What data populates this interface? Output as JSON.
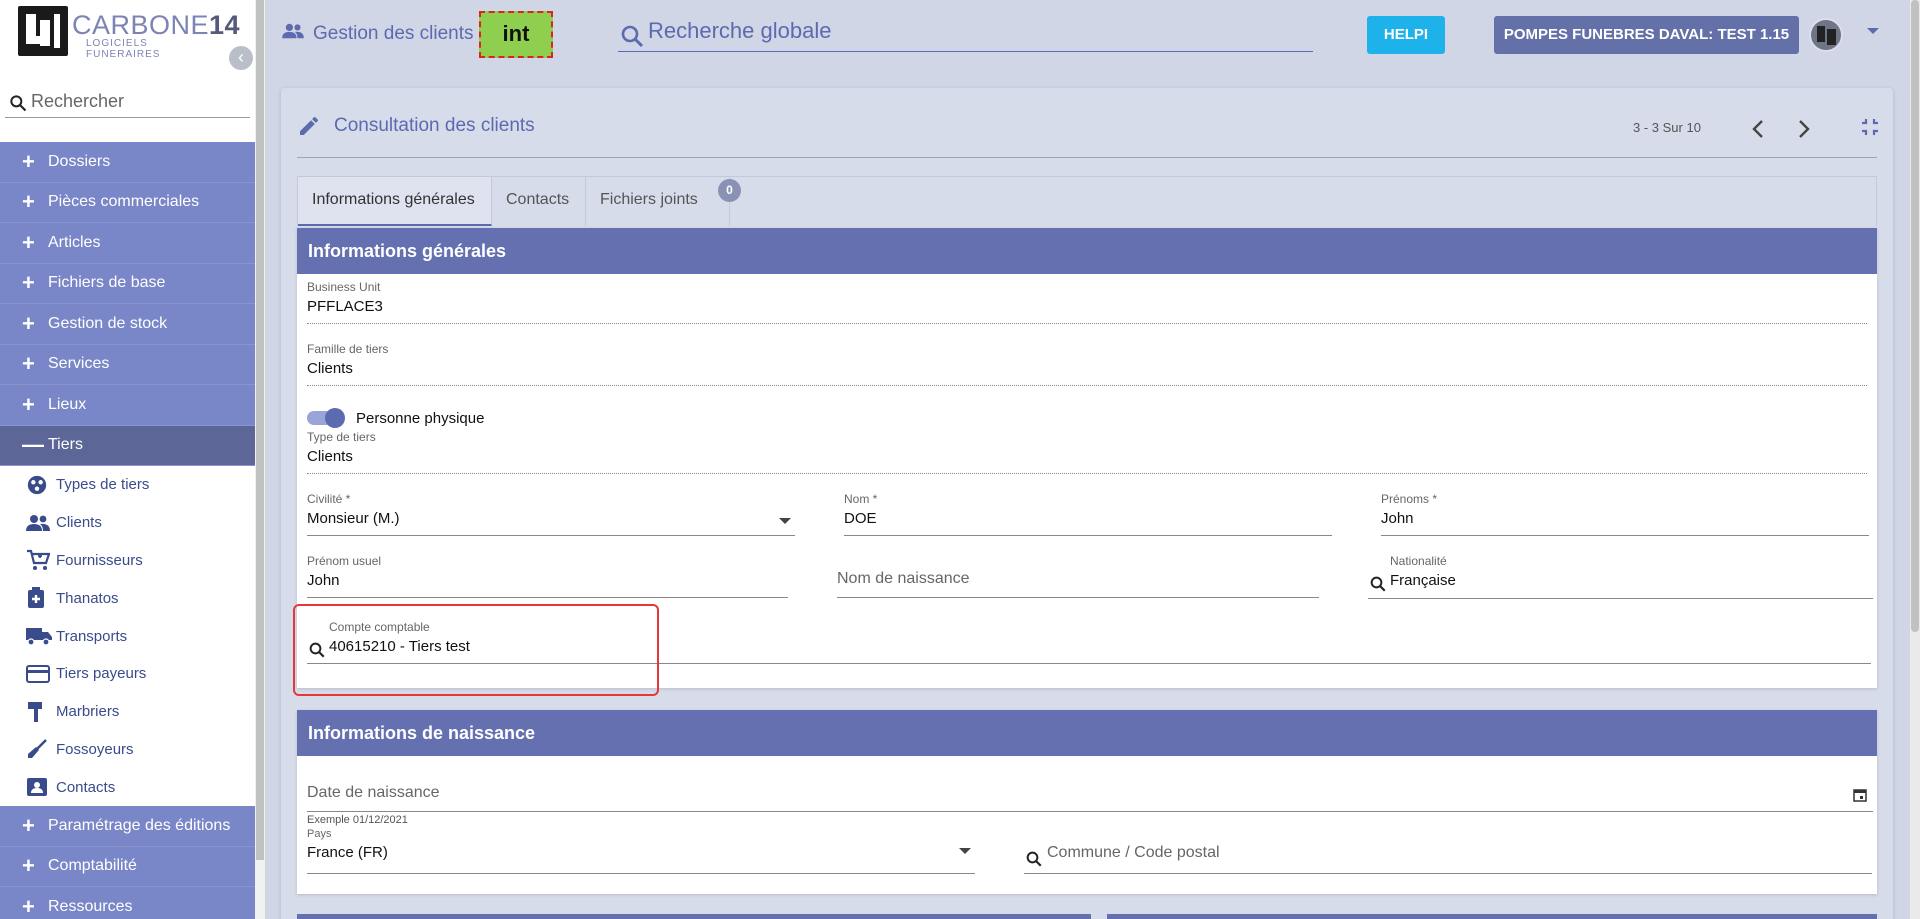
{
  "brand": {
    "name_main": "CARBONE",
    "name_bold": "14",
    "subtitle": "LOGICIELS FUNERAIRES"
  },
  "sidebar": {
    "search_placeholder": "Rechercher",
    "collapse_glyph": "‹",
    "items": [
      {
        "label": "Dossiers",
        "sym": "+"
      },
      {
        "label": "Pièces commerciales",
        "sym": "+"
      },
      {
        "label": "Articles",
        "sym": "+"
      },
      {
        "label": "Fichiers de base",
        "sym": "+"
      },
      {
        "label": "Gestion de stock",
        "sym": "+"
      },
      {
        "label": "Services",
        "sym": "+"
      },
      {
        "label": "Lieux",
        "sym": "+"
      },
      {
        "label": "Tiers",
        "sym": "—"
      }
    ],
    "subitems": [
      {
        "label": "Types de tiers",
        "icon": "types-icon"
      },
      {
        "label": "Clients",
        "icon": "people-icon"
      },
      {
        "label": "Fournisseurs",
        "icon": "cart-icon"
      },
      {
        "label": "Thanatos",
        "icon": "medical-icon"
      },
      {
        "label": "Transports",
        "icon": "truck-icon"
      },
      {
        "label": "Tiers payeurs",
        "icon": "card-icon"
      },
      {
        "label": "Marbriers",
        "icon": "hammer-icon"
      },
      {
        "label": "Fossoyeurs",
        "icon": "shovel-icon"
      },
      {
        "label": "Contacts",
        "icon": "contact-icon"
      }
    ],
    "items_after": [
      {
        "label": "Paramétrage des éditions",
        "sym": "+"
      },
      {
        "label": "Comptabilité",
        "sym": "+"
      },
      {
        "label": "Ressources",
        "sym": "+"
      }
    ]
  },
  "topbar": {
    "breadcrumb": "Gestion des clients",
    "env_badge": "int",
    "global_search_placeholder": "Recherche globale",
    "help_label": "HELPI",
    "company_label": "POMPES FUNEBRES DAVAL: TEST 1.15"
  },
  "card": {
    "title": "Consultation des clients",
    "pager": "3 - 3 Sur 10",
    "tabs": [
      {
        "label": "Informations générales"
      },
      {
        "label": "Contacts"
      },
      {
        "label": "Fichiers joints",
        "badge": "0"
      }
    ]
  },
  "general": {
    "title": "Informations générales",
    "business_unit": {
      "label": "Business Unit",
      "value": "PFFLACE3"
    },
    "famille": {
      "label": "Famille de tiers",
      "value": "Clients"
    },
    "personne_physique": {
      "label": "Personne physique",
      "on": true
    },
    "type_tiers": {
      "label": "Type de tiers",
      "value": "Clients"
    },
    "civilite": {
      "label": "Civilité *",
      "value": "Monsieur (M.)"
    },
    "nom": {
      "label": "Nom *",
      "value": "DOE"
    },
    "prenoms": {
      "label": "Prénoms *",
      "value": "John"
    },
    "prenom_usuel": {
      "label": "Prénom usuel",
      "value": "John"
    },
    "nom_naissance": {
      "placeholder": "Nom de naissance"
    },
    "nationalite": {
      "label": "Nationalité",
      "value": "Française"
    },
    "compte": {
      "label": "Compte comptable",
      "value": "40615210 - Tiers test"
    }
  },
  "birth": {
    "title": "Informations de naissance",
    "date": {
      "placeholder": "Date de naissance",
      "hint": "Exemple 01/12/2021"
    },
    "pays": {
      "label": "Pays",
      "value": "France (FR)"
    },
    "commune": {
      "placeholder": "Commune / Code postal"
    }
  },
  "colors": {
    "nav_bg": "#7986c7",
    "nav_active": "#5c6797",
    "section_head": "#6470b0",
    "accent": "#5c6ab0",
    "help": "#1eb2ea",
    "env_badge": "#8fcf50",
    "highlight": "#e53939"
  }
}
